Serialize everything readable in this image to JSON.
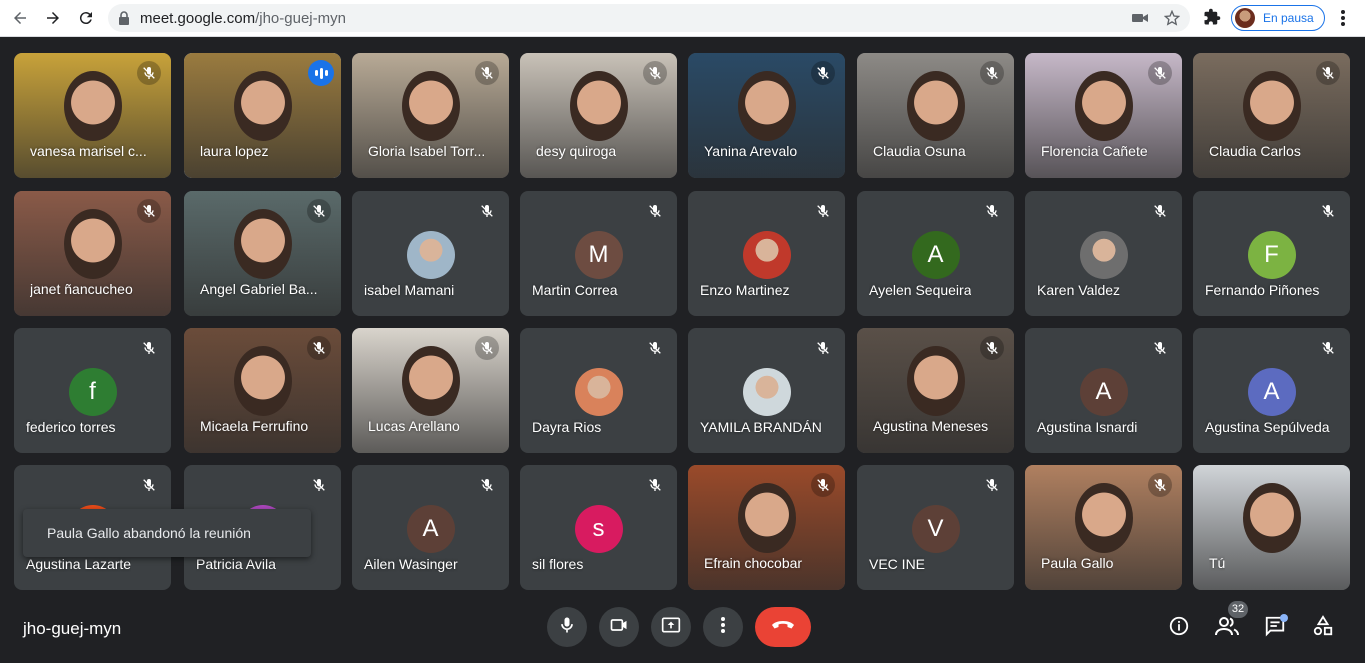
{
  "browser": {
    "url_host": "meet.google.com",
    "url_path": "/jho-guej-myn",
    "profile_label": "En pausa"
  },
  "tiles": [
    {
      "name": "vanesa marisel c...",
      "kind": "video",
      "muted": true,
      "bg": "#c8a23a"
    },
    {
      "name": "laura lopez",
      "kind": "video",
      "muted": false,
      "speaking": true,
      "bg": "#9a7b3f"
    },
    {
      "name": "Gloria Isabel Torr...",
      "kind": "video",
      "muted": true,
      "bg": "#b8aa96"
    },
    {
      "name": "desy quiroga",
      "kind": "video",
      "muted": true,
      "bg": "#c9c2b8"
    },
    {
      "name": "Yanina Arevalo",
      "kind": "video",
      "muted": true,
      "bg": "#2a4a66"
    },
    {
      "name": "Claudia Osuna",
      "kind": "video",
      "muted": true,
      "bg": "#8d8a86"
    },
    {
      "name": "Florencia Cañete",
      "kind": "video",
      "muted": true,
      "bg": "#c6b8c8"
    },
    {
      "name": "Claudia Carlos",
      "kind": "video",
      "muted": true,
      "bg": "#7a6c5e"
    },
    {
      "name": "janet ñancucheo",
      "kind": "video",
      "muted": true,
      "bg": "#8a5a48"
    },
    {
      "name": "Angel Gabriel Ba...",
      "kind": "video",
      "muted": true,
      "bg": "#5a6a6a"
    },
    {
      "name": "isabel Mamani",
      "kind": "photo",
      "muted": true,
      "photo_color": "#9fb6c8"
    },
    {
      "name": "Martin Correa",
      "kind": "avatar",
      "muted": true,
      "letter": "M",
      "color": "#6d4c41"
    },
    {
      "name": "Enzo Martinez",
      "kind": "photo",
      "muted": true,
      "photo_color": "#c0392b"
    },
    {
      "name": "Ayelen Sequeira",
      "kind": "avatar",
      "muted": true,
      "letter": "A",
      "color": "#33691e"
    },
    {
      "name": "Karen Valdez",
      "kind": "photo",
      "muted": true,
      "photo_color": "#6e6e6e"
    },
    {
      "name": "Fernando Piñones",
      "kind": "avatar",
      "muted": true,
      "letter": "F",
      "color": "#7cb342"
    },
    {
      "name": "federico torres",
      "kind": "avatar",
      "muted": true,
      "letter": "f",
      "color": "#2e7d32"
    },
    {
      "name": "Micaela Ferrufino",
      "kind": "video",
      "muted": true,
      "bg": "#6b4c3a"
    },
    {
      "name": "Lucas Arellano",
      "kind": "video",
      "muted": true,
      "bg": "#d9d4cc"
    },
    {
      "name": "Dayra Rios",
      "kind": "photo",
      "muted": true,
      "photo_color": "#d9825b"
    },
    {
      "name": "YAMILA BRANDÁN",
      "kind": "photo",
      "muted": true,
      "photo_color": "#cfd8dc"
    },
    {
      "name": "Agustina Meneses",
      "kind": "video",
      "muted": true,
      "bg": "#5a5048"
    },
    {
      "name": "Agustina Isnardi",
      "kind": "avatar",
      "muted": true,
      "letter": "A",
      "color": "#5d4037"
    },
    {
      "name": "Agustina Sepúlveda",
      "kind": "avatar",
      "muted": true,
      "letter": "A",
      "color": "#5c6bc0"
    },
    {
      "name": "Agustina Lazarte",
      "kind": "avatar",
      "muted": true,
      "letter": "A",
      "color": "#e64a19"
    },
    {
      "name": "Patricia Avila",
      "kind": "avatar",
      "muted": true,
      "letter": "P",
      "color": "#ab47bc"
    },
    {
      "name": "Ailen Wasinger",
      "kind": "avatar",
      "muted": true,
      "letter": "A",
      "color": "#5d4037"
    },
    {
      "name": "sil flores",
      "kind": "avatar",
      "muted": true,
      "letter": "s",
      "color": "#d81b60"
    },
    {
      "name": "Efrain chocobar",
      "kind": "video",
      "muted": true,
      "bg": "#9a4a2a"
    },
    {
      "name": "VEC INE",
      "kind": "avatar",
      "muted": true,
      "letter": "V",
      "color": "#5d4037"
    },
    {
      "name": "Paula Gallo",
      "kind": "video",
      "muted": true,
      "bg": "#b08060"
    },
    {
      "name": "Tú",
      "kind": "video",
      "muted": false,
      "bg": "#d0d4d8"
    }
  ],
  "toast": {
    "text": "Paula Gallo abandonó la reunión"
  },
  "meeting": {
    "code": "jho-guej-myn",
    "participant_count": "32"
  },
  "icons": {
    "back": "back-arrow-icon",
    "forward": "forward-arrow-icon",
    "reload": "reload-icon",
    "lock": "lock-icon",
    "camera_blocked": "camera-icon",
    "star": "star-icon",
    "extensions": "puzzle-icon",
    "chrome_menu": "more-vert-icon",
    "mic": "microphone-icon",
    "camera": "videocam-icon",
    "present": "present-screen-icon",
    "more": "more-vert-icon",
    "hangup": "call-end-icon",
    "info": "info-icon",
    "people": "people-icon",
    "chat": "chat-icon",
    "activities": "activities-icon"
  },
  "colors": {
    "hangup": "#ea4335",
    "tile_bg": "#3c4043",
    "page_bg": "#202124",
    "speaking_blue": "#1a73e8"
  }
}
